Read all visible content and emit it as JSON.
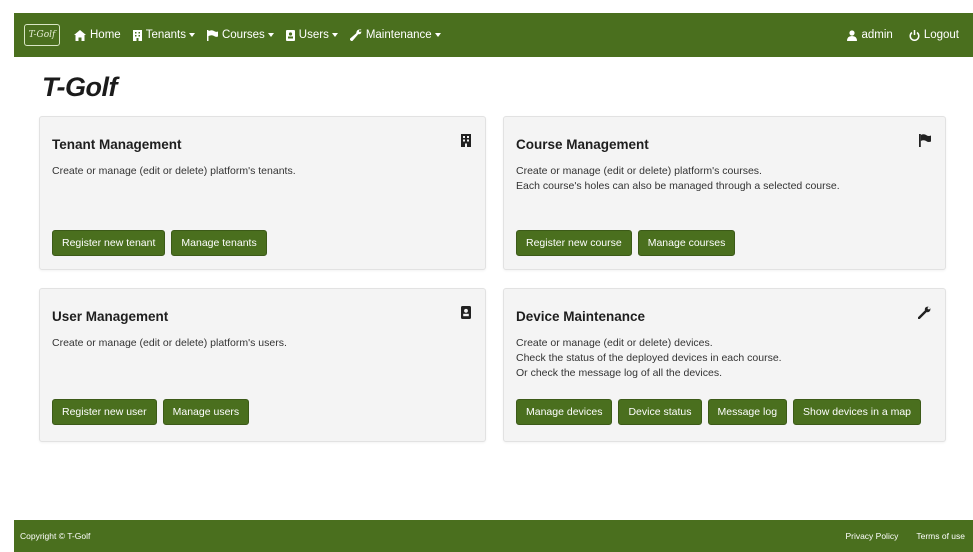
{
  "navbar": {
    "brand_text": "T-Golf",
    "items": [
      {
        "label": "Home",
        "icon": "home-icon"
      },
      {
        "label": "Tenants",
        "icon": "building-icon"
      },
      {
        "label": "Courses",
        "icon": "flag-icon"
      },
      {
        "label": "Users",
        "icon": "id-card-icon"
      },
      {
        "label": "Maintenance",
        "icon": "wrench-icon"
      }
    ],
    "user": {
      "label": "admin",
      "icon": "user-icon"
    },
    "logout": {
      "label": "Logout",
      "icon": "power-icon"
    },
    "color": "#4a6f1e"
  },
  "page_title": "T-Golf",
  "cards": {
    "tenant": {
      "title": "Tenant Management",
      "icon": "building-icon",
      "lines": [
        "Create or manage (edit or delete) platform's tenants."
      ],
      "buttons": [
        "Register new tenant",
        "Manage tenants"
      ]
    },
    "course": {
      "title": "Course Management",
      "icon": "flag-icon",
      "lines": [
        "Create or manage (edit or delete) platform's courses.",
        "Each course's holes can also be managed through a selected course."
      ],
      "buttons": [
        "Register new course",
        "Manage courses"
      ]
    },
    "user": {
      "title": "User Management",
      "icon": "id-card-icon",
      "lines": [
        "Create or manage (edit or delete) platform's users."
      ],
      "buttons": [
        "Register new user",
        "Manage users"
      ]
    },
    "device": {
      "title": "Device Maintenance",
      "icon": "wrench-icon",
      "lines": [
        "Create or manage (edit or delete) devices.",
        "Check the status of the deployed devices in each course.",
        "Or check the message log of all the devices."
      ],
      "buttons": [
        "Manage devices",
        "Device status",
        "Message log",
        "Show devices in a map"
      ]
    }
  },
  "footer": {
    "copyright": "Copyright © T-Golf",
    "links": [
      "Privacy Policy",
      "Terms of use"
    ]
  }
}
